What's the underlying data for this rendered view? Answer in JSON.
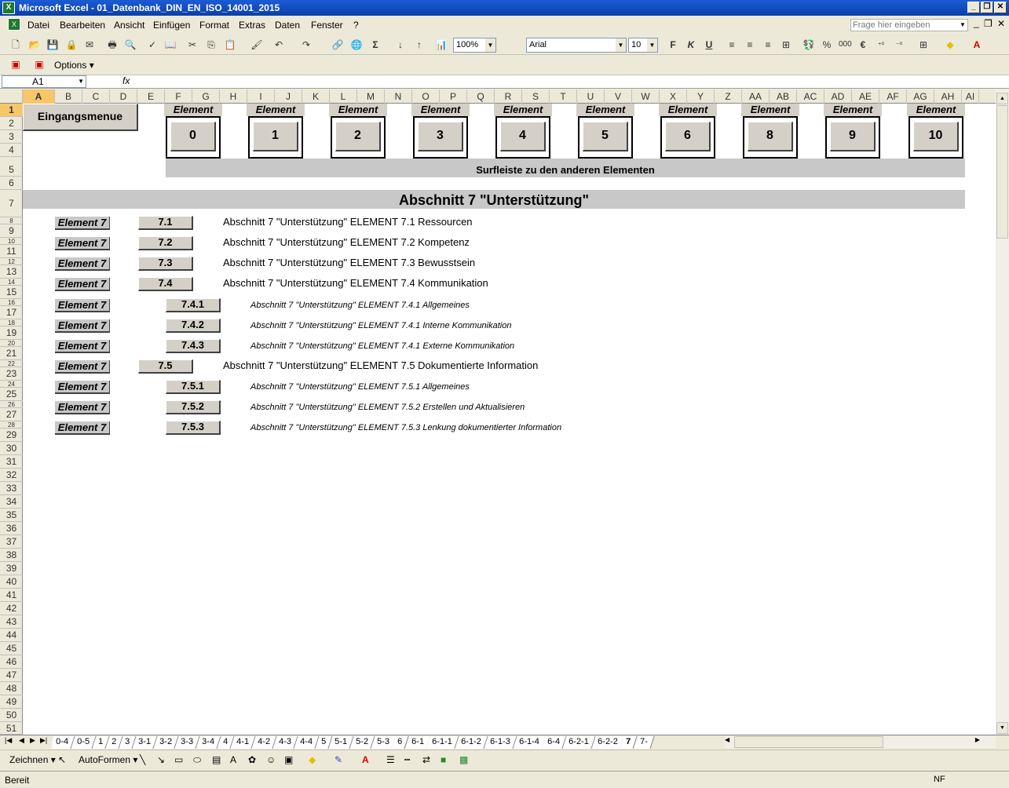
{
  "window": {
    "title": "Microsoft Excel - 01_Datenbank_DIN_EN_ISO_14001_2015",
    "minimize": "_",
    "restore": "❐",
    "close": "✕"
  },
  "menu": {
    "items": [
      "Datei",
      "Bearbeiten",
      "Ansicht",
      "Einfügen",
      "Format",
      "Extras",
      "Daten",
      "Fenster",
      "?"
    ],
    "help_placeholder": "Frage hier eingeben"
  },
  "toolbar": {
    "zoom": "100%",
    "font": "Arial",
    "font_size": "10",
    "bold": "F",
    "italic": "K",
    "underline": "U",
    "percent": "%",
    "thousands": "000",
    "euro": "€",
    "sigma": "Σ"
  },
  "toolbar2": {
    "options": "Options ▾"
  },
  "formula": {
    "cell_ref": "A1",
    "fx": "fx",
    "content": ""
  },
  "columns": [
    "A",
    "B",
    "C",
    "D",
    "E",
    "F",
    "G",
    "H",
    "I",
    "J",
    "K",
    "L",
    "M",
    "N",
    "O",
    "P",
    "Q",
    "R",
    "S",
    "T",
    "U",
    "V",
    "W",
    "X",
    "Y",
    "Z",
    "AA",
    "AB",
    "AC",
    "AD",
    "AE",
    "AF",
    "AG",
    "AH",
    "AI"
  ],
  "rows": [
    "1",
    "2",
    "3",
    "4",
    "5",
    "6",
    "7",
    "8",
    "9",
    "10",
    "11",
    "12",
    "13",
    "14",
    "15",
    "16",
    "17",
    "18",
    "19",
    "20",
    "21",
    "22",
    "23",
    "24",
    "25",
    "26",
    "27",
    "28",
    "29",
    "30",
    "31",
    "32",
    "33",
    "34",
    "35",
    "36",
    "37",
    "38",
    "39",
    "40",
    "41",
    "42",
    "43",
    "44",
    "45",
    "46",
    "47",
    "48",
    "49",
    "50",
    "51"
  ],
  "sheet": {
    "menu_button": "Eingangsmenue",
    "element_label": "Element",
    "elements": [
      "0",
      "1",
      "2",
      "3",
      "4",
      "5",
      "6",
      "8",
      "9",
      "10"
    ],
    "surfleiste": "Surfleiste zu den anderen Elementen",
    "section_title": "Abschnitt 7 \"Unterstützung\"",
    "entries": [
      {
        "tag": "Element 7",
        "num": "7.1",
        "text": "Abschnitt 7 \"Unterstützung\" ELEMENT 7.1 Ressourcen",
        "sub": false
      },
      {
        "tag": "Element 7",
        "num": "7.2",
        "text": "Abschnitt 7 \"Unterstützung\" ELEMENT 7.2 Kompetenz",
        "sub": false
      },
      {
        "tag": "Element 7",
        "num": "7.3",
        "text": "Abschnitt 7 \"Unterstützung\" ELEMENT 7.3 Bewusstsein",
        "sub": false
      },
      {
        "tag": "Element 7",
        "num": "7.4",
        "text": "Abschnitt 7 \"Unterstützung\" ELEMENT 7.4 Kommunikation",
        "sub": false
      },
      {
        "tag": "Element 7",
        "num": "7.4.1",
        "text": "Abschnitt 7 \"Unterstützung\" ELEMENT 7.4.1 Allgemeines",
        "sub": true
      },
      {
        "tag": "Element 7",
        "num": "7.4.2",
        "text": "Abschnitt 7 \"Unterstützung\" ELEMENT 7.4.1 Interne Kommunikation",
        "sub": true
      },
      {
        "tag": "Element 7",
        "num": "7.4.3",
        "text": "Abschnitt 7 \"Unterstützung\" ELEMENT 7.4.1 Externe Kommunikation",
        "sub": true
      },
      {
        "tag": "Element 7",
        "num": "7.5",
        "text": "Abschnitt 7 \"Unterstützung\" ELEMENT 7.5 Dokumentierte Information",
        "sub": false
      },
      {
        "tag": "Element 7",
        "num": "7.5.1",
        "text": "Abschnitt 7 \"Unterstützung\" ELEMENT 7.5.1 Allgemeines",
        "sub": true
      },
      {
        "tag": "Element 7",
        "num": "7.5.2",
        "text": "Abschnitt 7 \"Unterstützung\" ELEMENT 7.5.2 Erstellen und Aktualisieren",
        "sub": true
      },
      {
        "tag": "Element 7",
        "num": "7.5.3",
        "text": "Abschnitt 7 \"Unterstützung\" ELEMENT 7.5.3 Lenkung dokumentierter Information",
        "sub": true
      }
    ]
  },
  "tabs": {
    "items": [
      "0-4",
      "0-5",
      "1",
      "2",
      "3",
      "3-1",
      "3-2",
      "3-3",
      "3-4",
      "4",
      "4-1",
      "4-2",
      "4-3",
      "4-4",
      "5",
      "5-1",
      "5-2",
      "5-3",
      "6",
      "6-1",
      "6-1-1",
      "6-1-2",
      "6-1-3",
      "6-1-4",
      "6-4",
      "6-2-1",
      "6-2-2",
      "7",
      "7-"
    ],
    "active": "7"
  },
  "drawbar": {
    "draw": "Zeichnen ▾",
    "autoshapes": "AutoFormen ▾"
  },
  "status": {
    "left": "Bereit",
    "right": "NF"
  }
}
